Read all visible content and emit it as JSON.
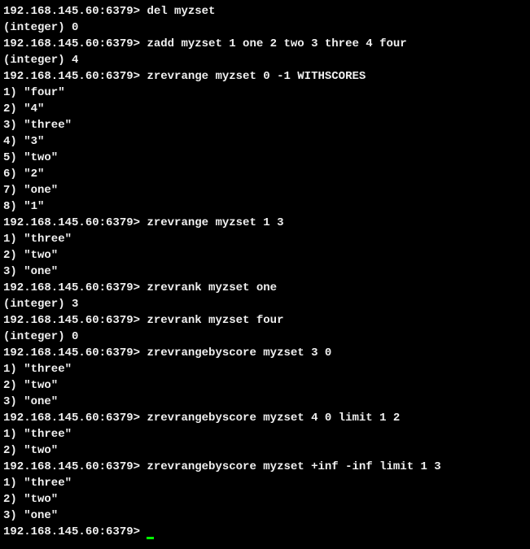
{
  "prompt": "192.168.145.60:6379> ",
  "blocks": [
    {
      "cmd": "del myzset",
      "out": [
        "(integer) 0"
      ]
    },
    {
      "cmd": "zadd myzset 1 one 2 two 3 three 4 four",
      "out": [
        "(integer) 4"
      ]
    },
    {
      "cmd": "zrevrange myzset 0 -1 WITHSCORES",
      "out": [
        "1) \"four\"",
        "2) \"4\"",
        "3) \"three\"",
        "4) \"3\"",
        "5) \"two\"",
        "6) \"2\"",
        "7) \"one\"",
        "8) \"1\""
      ]
    },
    {
      "cmd": "zrevrange myzset 1 3",
      "out": [
        "1) \"three\"",
        "2) \"two\"",
        "3) \"one\""
      ]
    },
    {
      "cmd": "zrevrank myzset one",
      "out": [
        "(integer) 3"
      ]
    },
    {
      "cmd": "zrevrank myzset four",
      "out": [
        "(integer) 0"
      ]
    },
    {
      "cmd": "zrevrangebyscore myzset 3 0",
      "out": [
        "1) \"three\"",
        "2) \"two\"",
        "3) \"one\""
      ]
    },
    {
      "cmd": "zrevrangebyscore myzset 4 0 limit 1 2",
      "out": [
        "1) \"three\"",
        "2) \"two\""
      ]
    },
    {
      "cmd": "zrevrangebyscore myzset +inf -inf limit 1 3",
      "out": [
        "1) \"three\"",
        "2) \"two\"",
        "3) \"one\""
      ]
    }
  ]
}
